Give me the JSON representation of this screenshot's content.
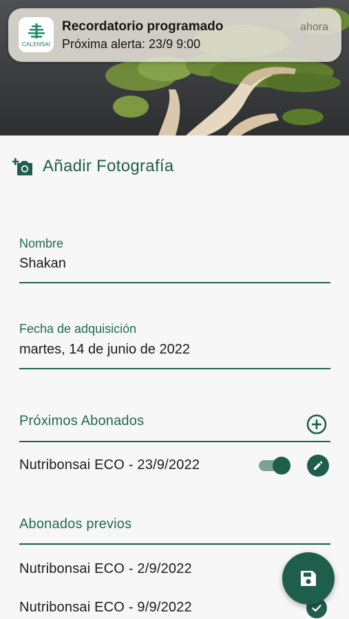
{
  "notification": {
    "app_name": "CALENSAI",
    "title": "Recordatorio programado",
    "body": "Próxima alerta: 23/9 9:00",
    "time": "ahora"
  },
  "photo": {
    "add_label": "Añadir Fotografía"
  },
  "form": {
    "name_label": "Nombre",
    "name_value": "Shakan",
    "date_label": "Fecha de adquisición",
    "date_value": "martes, 14 de junio de 2022"
  },
  "upcoming": {
    "title": "Próximos Abonados",
    "items": [
      {
        "text": "Nutribonsai ECO - 23/9/2022",
        "enabled": true
      }
    ]
  },
  "previous": {
    "title": "Abonados previos",
    "items": [
      {
        "text": "Nutribonsai ECO - 2/9/2022"
      },
      {
        "text": "Nutribonsai ECO - 9/9/2022"
      }
    ]
  },
  "colors": {
    "primary": "#1f5e4a",
    "toggle_track": "#7aa394",
    "background": "#f7f7f7"
  },
  "icons": [
    "add-photo-icon",
    "add-circle-icon",
    "edit-pencil-icon",
    "check-circle-icon",
    "save-floppy-icon",
    "calensai-logo-icon"
  ]
}
